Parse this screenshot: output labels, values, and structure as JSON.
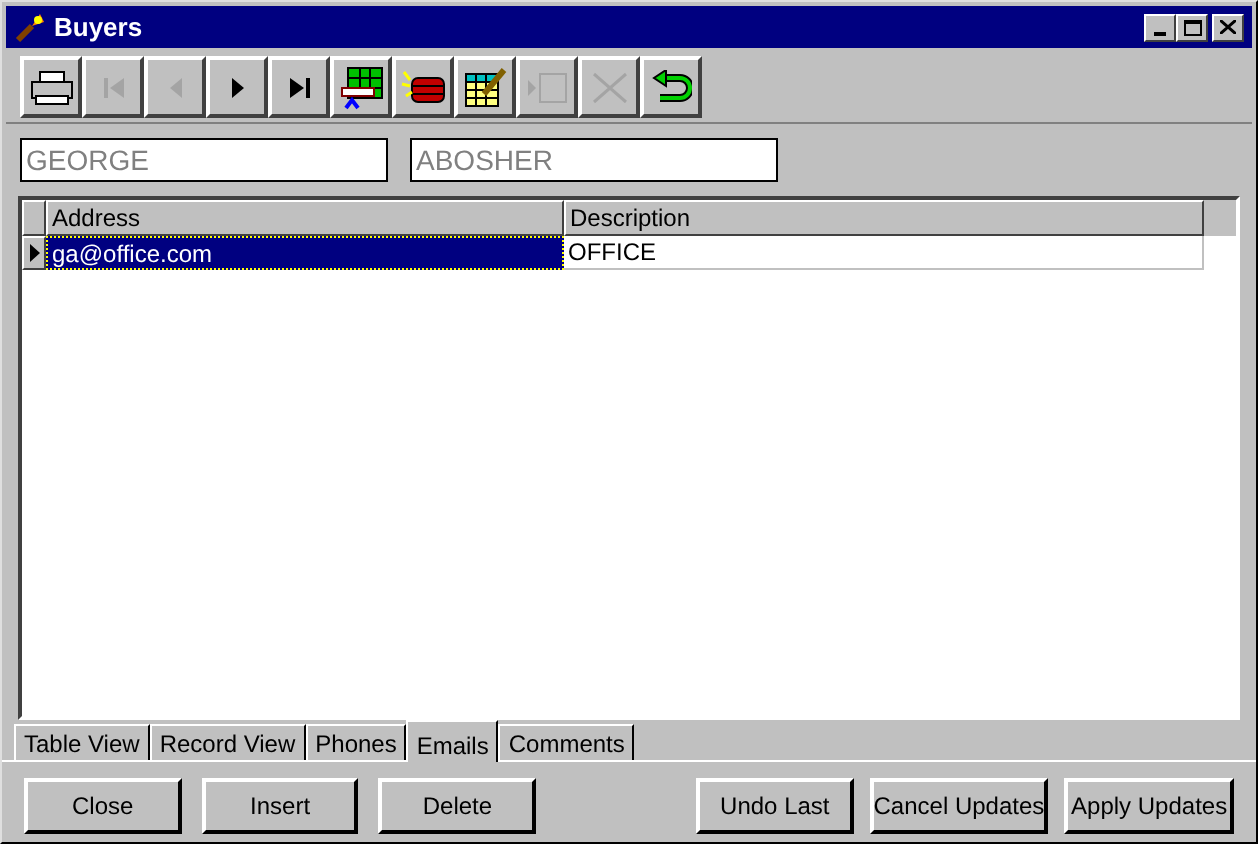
{
  "window": {
    "title": "Buyers"
  },
  "toolbar": [
    {
      "kind": "print",
      "disabled": false
    },
    {
      "kind": "first",
      "disabled": true
    },
    {
      "kind": "prev",
      "disabled": true
    },
    {
      "kind": "next",
      "disabled": false
    },
    {
      "kind": "last",
      "disabled": false
    },
    {
      "kind": "grid",
      "disabled": false
    },
    {
      "kind": "dynamite",
      "disabled": false
    },
    {
      "kind": "edit",
      "disabled": false
    },
    {
      "kind": "insert",
      "disabled": true
    },
    {
      "kind": "cut",
      "disabled": true
    },
    {
      "kind": "undo",
      "disabled": false
    }
  ],
  "fields": [
    {
      "value": "GEORGE"
    },
    {
      "value": "ABOSHER"
    }
  ],
  "table": {
    "columns": [
      "Address",
      "Description"
    ],
    "rows": [
      {
        "cells": [
          "ga@office.com",
          "OFFICE"
        ],
        "selected": true
      }
    ]
  },
  "tabs": [
    {
      "label": "Table View",
      "selected": false
    },
    {
      "label": "Record View",
      "selected": false
    },
    {
      "label": "Phones",
      "selected": false
    },
    {
      "label": "Emails",
      "selected": true
    },
    {
      "label": "Comments",
      "selected": false
    }
  ],
  "buttons": [
    "Close",
    "Insert",
    "Delete",
    "Undo Last",
    "Cancel Updates",
    "Apply Updates"
  ]
}
